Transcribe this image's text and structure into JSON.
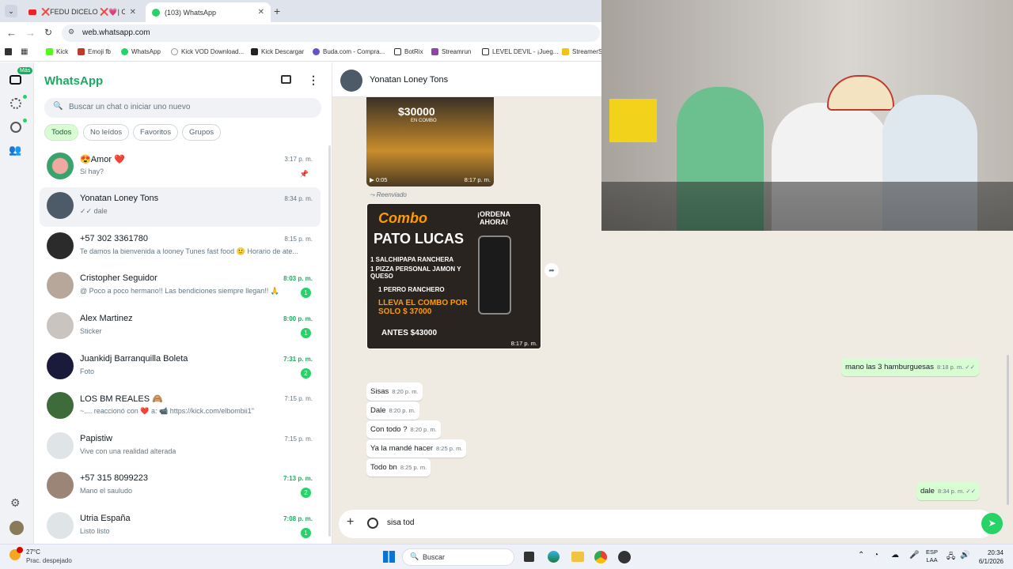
{
  "browser": {
    "tabs": [
      {
        "title": "❌FEDU DICELO ❌💗| CAMA",
        "active": false
      },
      {
        "title": "(103) WhatsApp",
        "active": true
      }
    ],
    "url": "web.whatsapp.com",
    "bookmarks": [
      "Kick",
      "Emoji fb",
      "WhatsApp",
      "Kick VOD Download...",
      "Kick Descargar",
      "Buda.com - Compra...",
      "BotRix",
      "Streamrun",
      "LEVEL DEVIL - ¡Jueg...",
      "StreamerS"
    ]
  },
  "rail": {
    "more_badge": "Más"
  },
  "sidebar": {
    "app_title": "WhatsApp",
    "search_placeholder": "Buscar un chat o iniciar uno nuevo",
    "filters": [
      "Todos",
      "No leídos",
      "Favoritos",
      "Grupos"
    ],
    "chats": [
      {
        "name": "😍Amor ❤️",
        "preview": "Si hay?",
        "time": "3:17 p. m.",
        "unread": "",
        "green": false
      },
      {
        "name": "Yonatan Loney Tons",
        "preview": "✓✓ dale",
        "time": "8:34 p. m.",
        "unread": "",
        "green": false
      },
      {
        "name": "+57 302 3361780",
        "preview": "Te damos la bienvenida a looney Tunes fast food 🙂 Horario de ate...",
        "time": "8:15 p. m.",
        "unread": "",
        "green": false
      },
      {
        "name": "Cristopher Seguidor",
        "preview": "@ Poco a poco hermano!!  Las bendiciones siempre llegan!! 🙏",
        "time": "8:03 p. m.",
        "unread": "1",
        "green": true
      },
      {
        "name": "Alex Martinez",
        "preview": "Sticker",
        "time": "8:00 p. m.",
        "unread": "1",
        "green": true
      },
      {
        "name": "Juankidj Barranquilla Boleta",
        "preview": "Foto",
        "time": "7:31 p. m.",
        "unread": "2",
        "green": true
      },
      {
        "name": "LOS BM REALES 🙈",
        "preview": "~.... reaccionó con ❤️ a: 📹 https://kick.com/elbombii1\"",
        "time": "7:15 p. m.",
        "unread": "",
        "green": false
      },
      {
        "name": "Papistiw",
        "preview": "Vive con una realidad alterada",
        "time": "7:15 p. m.",
        "unread": "",
        "green": false
      },
      {
        "name": "+57 315 8099223",
        "preview": "Mano el sauludo",
        "time": "7:13 p. m.",
        "unread": "2",
        "green": true
      },
      {
        "name": "Utria España",
        "preview": "Listo listo",
        "time": "7:08 p. m.",
        "unread": "1",
        "green": true
      }
    ]
  },
  "conversation": {
    "contact_name": "Yonatan Loney Tons",
    "video_price": "$30000",
    "video_price_sub": "EN COMBO",
    "video_duration": "0:05",
    "video_time": "8:17 p. m.",
    "forwarded_label": "Reenviado",
    "flyer": {
      "line1": "Combo",
      "line2": "PATO LUCAS",
      "cta": "¡ORDENA AHORA!",
      "items": [
        "1 SALCHIPAPA RANCHERA",
        "1 PIZZA PERSONAL JAMON Y QUESO",
        "1 PERRO RANCHERO"
      ],
      "offer": "LLEVA EL COMBO POR SOLO $ 37000",
      "before": "ANTES $43000",
      "time": "8:17 p. m."
    },
    "messages_out": [
      {
        "text": "mano las 3 hamburguesas",
        "time": "8:18 p. m. ✓✓"
      },
      {
        "text": "dale",
        "time": "8:34 p. m. ✓✓"
      }
    ],
    "messages_in": [
      {
        "text": "Sisas",
        "time": "8:20 p. m."
      },
      {
        "text": "Dale",
        "time": "8:20 p. m."
      },
      {
        "text": "Con todo ?",
        "time": "8:20 p. m."
      },
      {
        "text": "Ya la mandé hacer",
        "time": "8:25 p. m."
      },
      {
        "text": "Todo bn",
        "time": "8:25 p. m."
      }
    ],
    "composer_value": "sisa tod"
  },
  "taskbar": {
    "weather_temp": "27°C",
    "weather_desc": "Prac. despejado",
    "search_label": "Buscar",
    "lang": "ESP",
    "lang2": "LAA",
    "time": "20:34",
    "date": "6/1/2026"
  },
  "colors": {
    "accent": "#25d366",
    "brand": "#1daa61",
    "chat_bg": "#efeae2",
    "outgoing": "#d9fdd3"
  }
}
